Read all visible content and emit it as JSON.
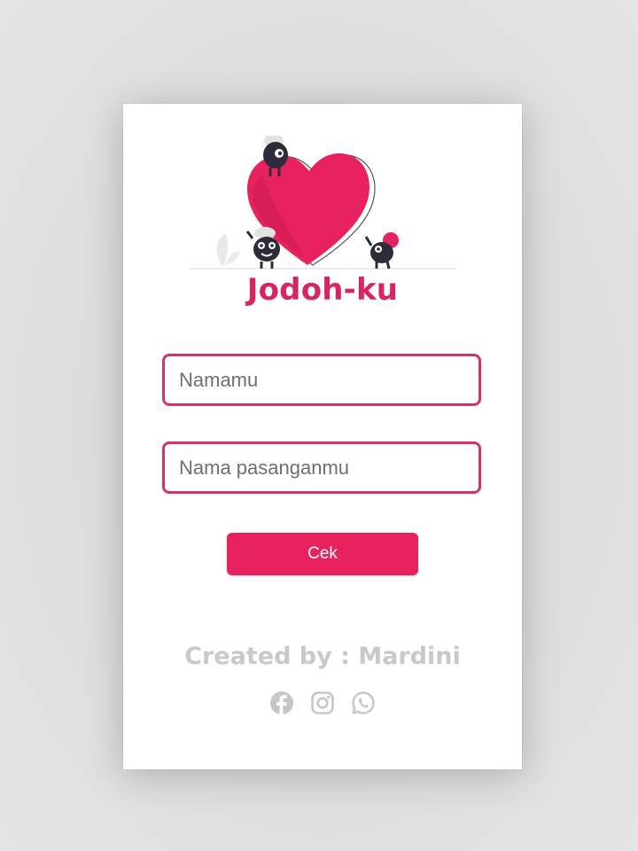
{
  "app": {
    "title": "Jodoh-ku",
    "accent_color": "#e8225f"
  },
  "form": {
    "name_placeholder": "Namamu",
    "name_value": "",
    "partner_placeholder": "Nama pasanganmu",
    "partner_value": "",
    "submit_label": "Cek"
  },
  "footer": {
    "credit": "Created by : Mardini",
    "socials": [
      {
        "icon": "facebook-icon"
      },
      {
        "icon": "instagram-icon"
      },
      {
        "icon": "whatsapp-icon"
      }
    ]
  },
  "illustration": {
    "icon": "heart-with-monsters-illustration"
  }
}
